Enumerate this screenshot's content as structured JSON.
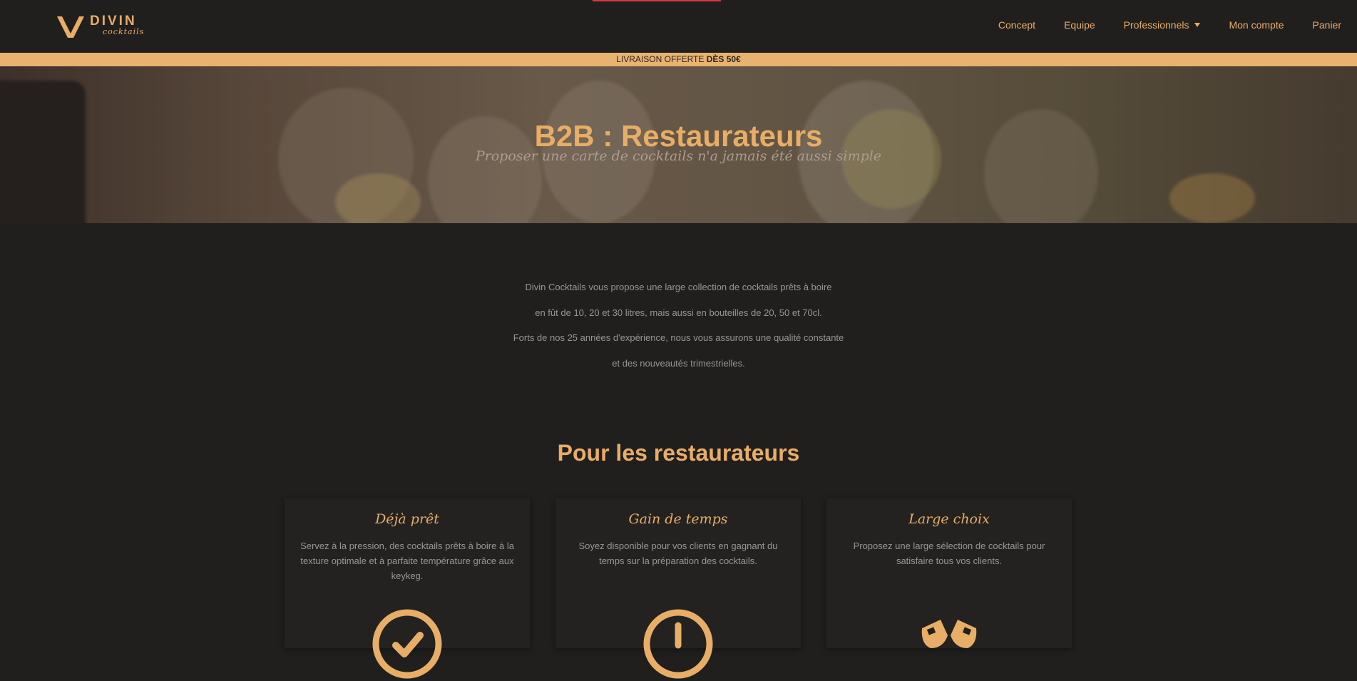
{
  "brand": {
    "name": "DIVIN",
    "tagline": "cocktails"
  },
  "nav": [
    {
      "label": "Concept"
    },
    {
      "label": "Equipe"
    },
    {
      "label": "Professionnels",
      "dropdown": true
    },
    {
      "label": "Mon compte"
    },
    {
      "label": "Panier"
    }
  ],
  "promo": {
    "text": "LIVRAISON OFFERTE ",
    "bold": "DÈS 50€"
  },
  "hero": {
    "title": "B2B : Restaurateurs",
    "subtitle": "Proposer une carte de cocktails n'a jamais été aussi simple"
  },
  "intro": {
    "lines": [
      "Divin Cocktails vous propose une large collection de cocktails prêts à boire",
      "en fût de 10, 20 et 30 litres, mais aussi en bouteilles de 20, 50 et 70cl.",
      "Forts de nos 25 années d'expérience, nous vous assurons une qualité constante",
      "et des nouveautés trimestrielles."
    ]
  },
  "section": {
    "title": "Pour les restaurateurs"
  },
  "cards": [
    {
      "title": "Déjà prêt",
      "text": "Servez à la pression, des cocktails prêts à boire à la texture optimale et à parfaite température grâce aux keykeg.",
      "icon": "check-circle-icon"
    },
    {
      "title": "Gain de temps",
      "text": "Soyez disponible pour vos clients en gagnant du temps sur la préparation des cocktails.",
      "icon": "clock-icon"
    },
    {
      "title": "Large choix",
      "text": "Proposez une large sélection de cocktails pour satisfaire tous vos clients.",
      "icon": "glasses-cheers-icon"
    }
  ],
  "colors": {
    "accent": "#e8ad66",
    "background": "#201f1e",
    "promo_bar": "#e8b36f",
    "top_line": "#d9363e"
  }
}
